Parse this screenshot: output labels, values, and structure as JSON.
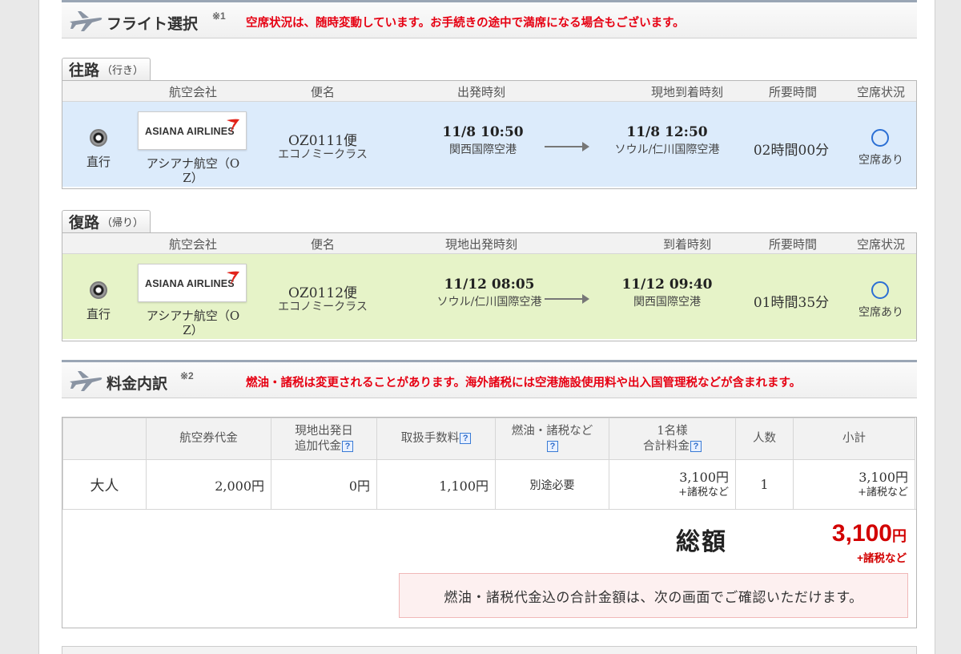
{
  "flight_section": {
    "title": "フライト選択",
    "note_mark": "※1",
    "note": "空席状況は、随時変動しています。お手続きの途中で満席になる場合もございます。"
  },
  "outbound": {
    "tab_main": "往路",
    "tab_sub": "（行き）",
    "headers": {
      "airline": "航空会社",
      "flight": "便名",
      "depart": "出発時刻",
      "arrive": "現地到着時刻",
      "duration": "所要時間",
      "seats": "空席状況"
    },
    "type": "直行",
    "airline_logo": "ASIANA AIRLINES",
    "airline_name_1": "アシアナ航空（O",
    "airline_name_2": "Z）",
    "flight_no": "OZ0111便",
    "cabin": "エコノミークラス",
    "depart_time": "11/8 10:50",
    "depart_airport": "関西国際空港",
    "arrive_time": "11/8 12:50",
    "arrive_airport": "ソウル/仁川国際空港",
    "duration": "02時間00分",
    "seat_status": "空席あり",
    "bg_color": "#dcebfb"
  },
  "inbound": {
    "tab_main": "復路",
    "tab_sub": "（帰り）",
    "headers": {
      "airline": "航空会社",
      "flight": "便名",
      "depart": "現地出発時刻",
      "arrive": "到着時刻",
      "duration": "所要時間",
      "seats": "空席状況"
    },
    "type": "直行",
    "airline_logo": "ASIANA AIRLINES",
    "airline_name_1": "アシアナ航空（O",
    "airline_name_2": "Z）",
    "flight_no": "OZ0112便",
    "cabin": "エコノミークラス",
    "depart_time": "11/12 08:05",
    "depart_airport": "ソウル/仁川国際空港",
    "arrive_time": "11/12 09:40",
    "arrive_airport": "関西国際空港",
    "duration": "01時間35分",
    "seat_status": "空席あり",
    "bg_color": "#e6f3c8"
  },
  "fare_section": {
    "title": "料金内訳",
    "note_mark": "※2",
    "note": "燃油・諸税は変更されることがあります。海外諸税には空港施設使用料や出入国管理税などが含まれます。",
    "headers": {
      "ticket": "航空券代金",
      "extra_1": "現地出発日",
      "extra_2": "追加代金",
      "fee": "取扱手数料",
      "tax": "燃油・諸税など",
      "per_1": "1名様",
      "per_2": "合計料金",
      "count": "人数",
      "subtotal": "小計"
    },
    "help_icon": "?",
    "row": {
      "label": "大人",
      "ticket": "2,000円",
      "extra": "0円",
      "fee": "1,100円",
      "tax": "別途必要",
      "per_person": "3,100円",
      "per_person_note": "+諸税など",
      "count": "1",
      "subtotal": "3,100円",
      "subtotal_note": "+諸税など"
    },
    "total_label": "総額",
    "total_amount": "3,100",
    "total_unit": "円",
    "total_note": "+諸税など",
    "notice": "燃油・諸税代金込の合計金額は、次の画面でご確認いただけます。"
  },
  "colors": {
    "accent_red": "#e60012",
    "price_red": "#d20000",
    "seat_circle": "#2b6fd4",
    "header_rule": "#9aa6b5"
  },
  "icons": [
    "airplane-icon",
    "radio-selected-icon",
    "asiana-wing-icon",
    "arrow-right-icon",
    "available-circle-icon",
    "help-icon"
  ]
}
